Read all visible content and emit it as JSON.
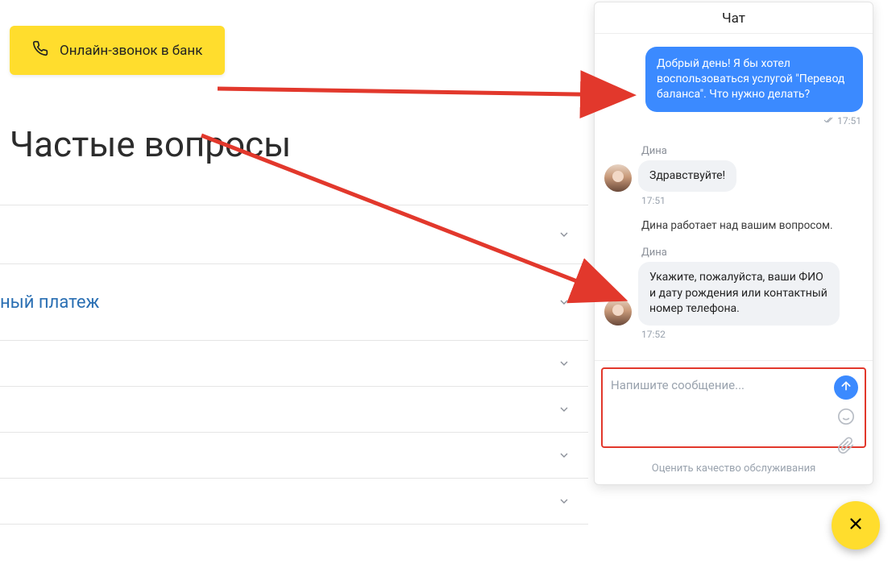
{
  "call_button_label": "Онлайн-звонок в банк",
  "page_title": "Частые вопросы",
  "accordion": {
    "row_payment_label": "ный платеж"
  },
  "chat": {
    "title": "Чат",
    "outgoing": {
      "text": "Добрый день! Я бы хотел воспользоваться услугой \"Перевод баланса\". Что нужно делать?",
      "time": "17:51"
    },
    "agent_name_1": "Дина",
    "msg1": {
      "text": "Здравствуйте!",
      "time": "17:51"
    },
    "system_note": "Дина работает над вашим вопросом.",
    "agent_name_2": "Дина",
    "msg2": {
      "text": "Укажите, пожалуйста, ваши ФИО и дату рождения или контактный номер телефона.",
      "time": "17:52"
    },
    "input_placeholder": "Напишите сообщение...",
    "footer": "Оценить качество обслуживания"
  },
  "colors": {
    "accent_yellow": "#ffdd2d",
    "accent_blue": "#3b8aff",
    "annotation_red": "#e2382c"
  }
}
